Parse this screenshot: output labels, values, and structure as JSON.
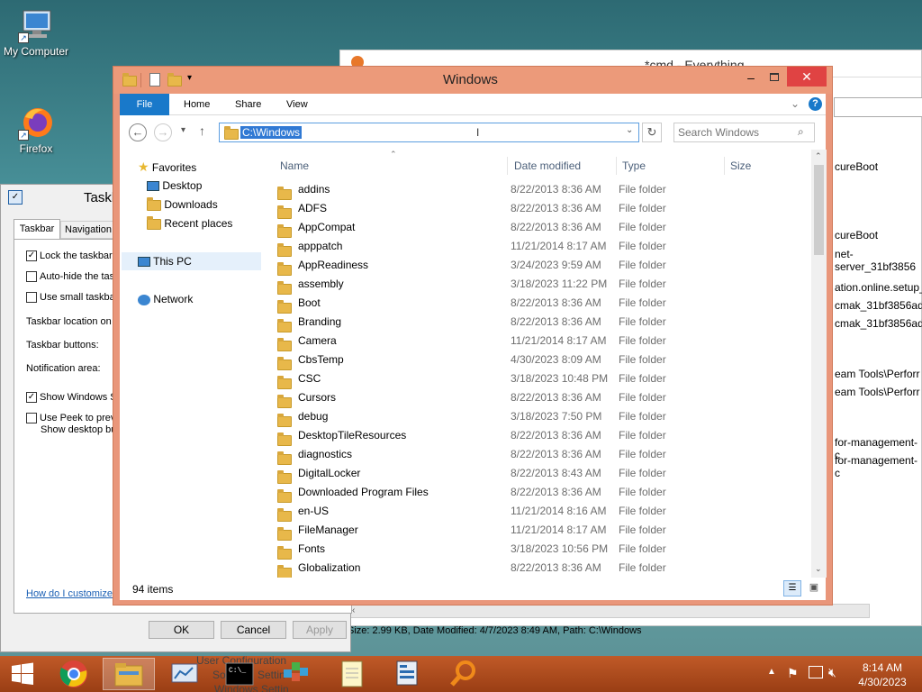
{
  "desktop": {
    "icons": [
      {
        "label": "My Computer"
      },
      {
        "label": "Firefox"
      }
    ]
  },
  "background_windows": {
    "cmd_title": "*cmd - Everything",
    "cmd_right_text": [
      "cureBoot",
      "cureBoot",
      "net-server_31bf3856",
      "ation.online.setup_3",
      "cmak_31bf3856ad3",
      "cmak_31bf3856ad3",
      "eam Tools\\Perforr",
      "eam Tools\\Perforr",
      "for-management-c",
      "for-management-c"
    ],
    "cmd_status": "Size: 2.99 KB, Date Modified: 4/7/2023 8:49 AM, Path: C:\\Windows",
    "taskbar_props": {
      "title": "Taskb",
      "tabs": [
        "Taskbar",
        "Navigation"
      ],
      "options": [
        {
          "label": "Lock the taskbar",
          "checked": true
        },
        {
          "label": "Auto-hide the tas",
          "checked": false
        },
        {
          "label": "Use small taskbar",
          "checked": false
        }
      ],
      "field_labels": [
        "Taskbar location on",
        "Taskbar buttons:",
        "Notification area:"
      ],
      "show_windows": "Show Windows S",
      "use_peek_1": "Use Peek to prev",
      "use_peek_2": "Show desktop bu",
      "link": "How do I customize",
      "ok": "OK",
      "cancel": "Cancel",
      "apply": "Apply"
    }
  },
  "explorer": {
    "title": "Windows",
    "tabs": {
      "file": "File",
      "home": "Home",
      "share": "Share",
      "view": "View"
    },
    "address": "C:\\Windows",
    "search_placeholder": "Search Windows",
    "nav": {
      "favorites": "Favorites",
      "desktop": "Desktop",
      "downloads": "Downloads",
      "recent": "Recent places",
      "thispc": "This PC",
      "network": "Network"
    },
    "columns": {
      "name": "Name",
      "date": "Date modified",
      "type": "Type",
      "size": "Size"
    },
    "files": [
      {
        "name": "addins",
        "date": "8/22/2013 8:36 AM",
        "type": "File folder"
      },
      {
        "name": "ADFS",
        "date": "8/22/2013 8:36 AM",
        "type": "File folder"
      },
      {
        "name": "AppCompat",
        "date": "8/22/2013 8:36 AM",
        "type": "File folder"
      },
      {
        "name": "apppatch",
        "date": "11/21/2014 8:17 AM",
        "type": "File folder"
      },
      {
        "name": "AppReadiness",
        "date": "3/24/2023 9:59 AM",
        "type": "File folder"
      },
      {
        "name": "assembly",
        "date": "3/18/2023 11:22 PM",
        "type": "File folder"
      },
      {
        "name": "Boot",
        "date": "8/22/2013 8:36 AM",
        "type": "File folder"
      },
      {
        "name": "Branding",
        "date": "8/22/2013 8:36 AM",
        "type": "File folder"
      },
      {
        "name": "Camera",
        "date": "11/21/2014 8:17 AM",
        "type": "File folder"
      },
      {
        "name": "CbsTemp",
        "date": "4/30/2023 8:09 AM",
        "type": "File folder"
      },
      {
        "name": "CSC",
        "date": "3/18/2023 10:48 PM",
        "type": "File folder"
      },
      {
        "name": "Cursors",
        "date": "8/22/2013 8:36 AM",
        "type": "File folder"
      },
      {
        "name": "debug",
        "date": "3/18/2023 7:50 PM",
        "type": "File folder"
      },
      {
        "name": "DesktopTileResources",
        "date": "8/22/2013 8:36 AM",
        "type": "File folder"
      },
      {
        "name": "diagnostics",
        "date": "8/22/2013 8:36 AM",
        "type": "File folder"
      },
      {
        "name": "DigitalLocker",
        "date": "8/22/2013 8:43 AM",
        "type": "File folder"
      },
      {
        "name": "Downloaded Program Files",
        "date": "8/22/2013 8:36 AM",
        "type": "File folder"
      },
      {
        "name": "en-US",
        "date": "11/21/2014 8:16 AM",
        "type": "File folder"
      },
      {
        "name": "FileManager",
        "date": "11/21/2014 8:17 AM",
        "type": "File folder"
      },
      {
        "name": "Fonts",
        "date": "3/18/2023 10:56 PM",
        "type": "File folder"
      },
      {
        "name": "Globalization",
        "date": "8/22/2013 8:36 AM",
        "type": "File folder"
      }
    ],
    "status": "94 items"
  },
  "taskbar": {
    "time": "8:14 AM",
    "date": "4/30/2023",
    "items": [
      "start",
      "chrome",
      "file-explorer",
      "control-panel",
      "cmd",
      "registry",
      "notepad",
      "server-manager",
      "everything"
    ],
    "tooltip": {
      "line1": "User Configuration",
      "line2": "So",
      "line3": "Settin",
      "line4": "Windows Settin"
    }
  },
  "colors": {
    "accent": "#ec9a7a",
    "file_tab": "#1979ca",
    "taskbar": "#b04a1a"
  }
}
